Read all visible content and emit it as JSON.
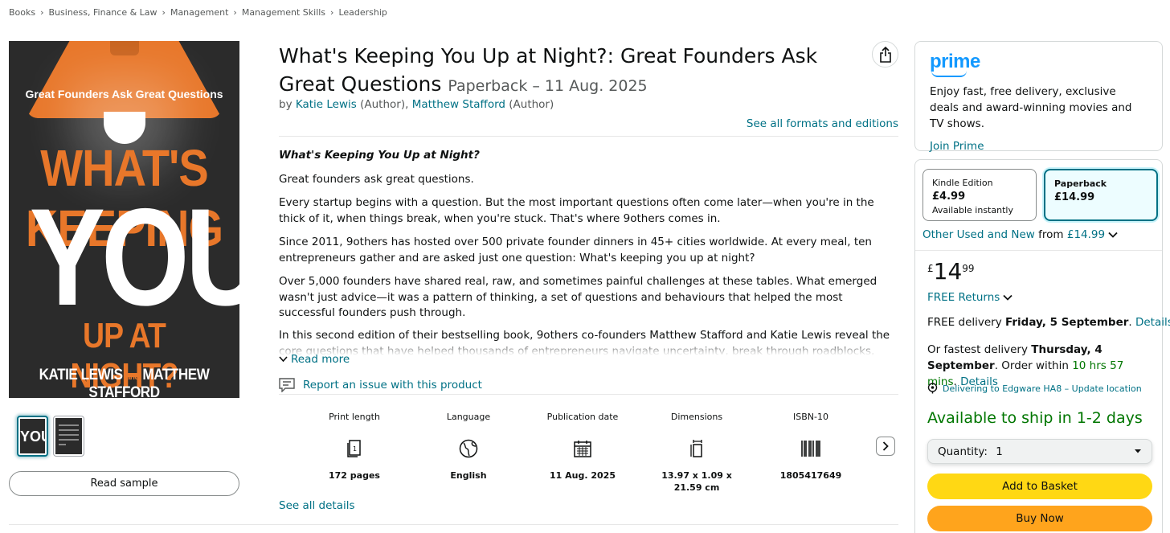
{
  "breadcrumb": [
    "Books",
    "Business, Finance & Law",
    "Management",
    "Management Skills",
    "Leadership"
  ],
  "cover": {
    "tagline": "Great Founders Ask Great Questions",
    "line1": "WHAT'S KEEPING",
    "line2": "YOU",
    "line3": "UP AT NIGHT?",
    "author1": "KATIE LEWIS",
    "and": "and",
    "author2": "MATTHEW STAFFORD",
    "thumb_text": "YOU"
  },
  "read_sample_label": "Read sample",
  "product": {
    "title": "What's Keeping You Up at Night?: Great Founders Ask Great Questions",
    "format_date": "Paperback – 11 Aug. 2025",
    "by": "by",
    "author1": "Katie Lewis",
    "author1_role": "(Author),",
    "author2": "Matthew Stafford",
    "author2_role": "(Author)",
    "see_formats": "See all formats and editions"
  },
  "description": {
    "heading": "What's Keeping You Up at Night?",
    "p1": "Great founders ask great questions.",
    "p2": "Every startup begins with a question. But the most important questions often come later—when you're in the thick of it, when things break, when you're stuck. That's where 9others comes in.",
    "p3": "Since 2011, 9others has hosted over 500 private founder dinners in 45+ cities worldwide. At every meal, ten entrepreneurs gather and are asked just one question: What's keeping you up at night?",
    "p4": "Over 5,000 founders have shared real, raw, and sometimes painful challenges at these tables. What emerged wasn't just advice—it was a pattern of thinking, a set of questions and behaviours that helped the most successful founders push through.",
    "p5": "In this second edition of their bestselling book, 9others co-founders Matthew Stafford and Katie Lewis reveal the core questions that have helped thousands of entrepreneurs navigate uncertainty, break through roadblocks, and build better",
    "read_more": "Read more",
    "report": "Report an issue with this product"
  },
  "attributes": [
    {
      "label": "Print length",
      "icon": "pages-icon",
      "value": "172 pages"
    },
    {
      "label": "Language",
      "icon": "globe-icon",
      "value": "English"
    },
    {
      "label": "Publication date",
      "icon": "calendar-icon",
      "value": "11 Aug. 2025"
    },
    {
      "label": "Dimensions",
      "icon": "ruler-icon",
      "value": "13.97 x 1.09 x 21.59 cm"
    },
    {
      "label": "ISBN-10",
      "icon": "barcode-icon",
      "value": "1805417649"
    }
  ],
  "see_all_details": "See all details",
  "prime": {
    "logo": "prime",
    "text": "Enjoy fast, free delivery, exclusive deals and award-winning movies and TV shows.",
    "join": "Join Prime"
  },
  "buybox": {
    "formats": [
      {
        "name": "Kindle Edition",
        "price": "£4.99",
        "note": "Available instantly",
        "selected": false
      },
      {
        "name": "Paperback",
        "price": "£14.99",
        "note": "",
        "selected": true
      }
    ],
    "other_used_link": "Other Used and New",
    "other_used_from": "from",
    "other_used_price": "£14.99",
    "price_currency": "£",
    "price_whole": "14",
    "price_fraction": "99",
    "free_returns": "FREE Returns",
    "delivery1_prefix": "FREE delivery",
    "delivery1_date": "Friday, 5 September",
    "delivery1_details": "Details",
    "delivery2_prefix": "Or fastest delivery",
    "delivery2_date": "Thursday, 4 September",
    "delivery2_order": "Order within",
    "delivery2_time": "10 hrs 57 mins",
    "delivery2_details": "Details",
    "deliver_to": "Delivering to Edgware HA8 – Update location",
    "availability": "Available to ship in 1-2 days",
    "quantity_label": "Quantity:",
    "quantity_value": "1",
    "add_to_basket": "Add to Basket",
    "buy_now": "Buy Now"
  },
  "colors": {
    "link": "#007185",
    "add_to_basket": "#ffd814",
    "buy_now": "#ffa41c",
    "available": "#007600",
    "prime_blue": "#1399ff",
    "cover_orange": "#e8772a"
  }
}
